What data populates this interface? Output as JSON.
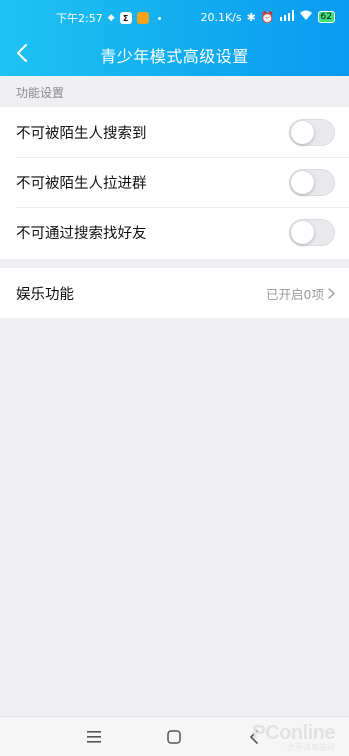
{
  "status_bar": {
    "time": "下午2:57",
    "network_speed": "20.1K/s",
    "battery": "62",
    "icons": [
      "app-icon-sigma",
      "app-icon-app",
      "dot",
      "bluetooth-icon",
      "alarm-icon",
      "signal-icon",
      "wifi-icon",
      "battery-icon"
    ]
  },
  "navbar": {
    "title": "青少年模式高级设置",
    "back_icon": "chevron-left-icon"
  },
  "section": {
    "label": "功能设置"
  },
  "settings": [
    {
      "label": "不可被陌生人搜索到",
      "enabled": false
    },
    {
      "label": "不可被陌生人拉进群",
      "enabled": false
    },
    {
      "label": "不可通过搜索找好友",
      "enabled": false
    }
  ],
  "entertainment": {
    "label": "娱乐功能",
    "value": "已开启0项"
  },
  "bottom_nav": {
    "icons": [
      "menu-icon",
      "home-icon",
      "back-icon"
    ]
  },
  "watermark": {
    "main": "PConline",
    "sub": "太平洋电脑网"
  },
  "colors": {
    "header_start": "#1fc3f2",
    "header_end": "#0a9bf0",
    "background": "#efeff4"
  }
}
